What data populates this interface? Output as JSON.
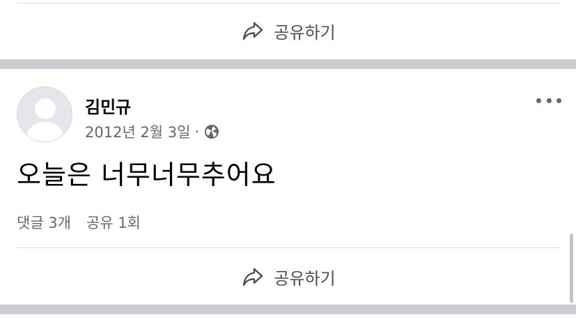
{
  "previous_post": {
    "share_label": "공유하기"
  },
  "post": {
    "author": {
      "name": "김민규"
    },
    "date": "2012년 2월 3일",
    "separator": "·",
    "privacy_icon": "globe-icon",
    "more_icon": "more-options-icon",
    "text": "오늘은 너무너무추어요",
    "stats": {
      "comments": "댓글 3개",
      "shares": "공유 1회"
    },
    "share_label": "공유하기"
  },
  "colors": {
    "section_gap": "#c9ccd1",
    "divider": "#dadde1",
    "secondary_text": "#65676b",
    "action_text": "#4b4f56"
  }
}
